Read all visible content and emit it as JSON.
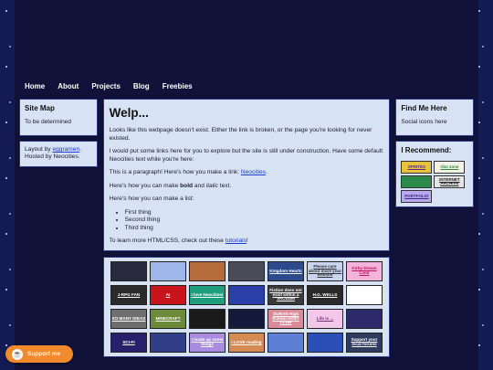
{
  "nav": {
    "items": [
      "Home",
      "About",
      "Projects",
      "Blog",
      "Freebies"
    ]
  },
  "left": {
    "sitemap_title": "Site Map",
    "sitemap_text": "To be determined",
    "credits_pre": "Layout by ",
    "credits_link": "eggramen",
    "credits_post": ".",
    "credits_line2": "Hosted by Neocities."
  },
  "main": {
    "title": "Welp...",
    "p1": "Looks like this webpage doesn't exist. Either the link is broken, or the page you're looking for never existed.",
    "p2": "I would put some links here for you to explore but the site is still under construction. Have some default Neocities text while you're here:",
    "p3_pre": "This is a paragraph! Here's how you make a link: ",
    "p3_link": "Neocities",
    "p3_post": ".",
    "p4_pre": "Here's how you can make ",
    "p4_bold": "bold",
    "p4_mid": " and ",
    "p4_italic": "italic",
    "p4_post": " text.",
    "p5": "Here's how you can make a list:",
    "list": [
      "First thing",
      "Second thing",
      "Third thing"
    ],
    "p6_pre": "To learn more HTML/CSS, check out these ",
    "p6_link": "tutorials",
    "p6_post": "!"
  },
  "right": {
    "findme_title": "Find Me Here",
    "findme_text": "Social icons here",
    "recommend_title": "I Recommend:",
    "badges": [
      "SPRITES",
      "ribo zone",
      "",
      "INTERNET ARCHIVE",
      "PORTFOLIO"
    ]
  },
  "buttons": [
    {
      "label": "",
      "bg": "#2a2a3e",
      "fg": "#ffffff"
    },
    {
      "label": "",
      "bg": "#9fb6e8",
      "fg": "#ffffff"
    },
    {
      "label": "",
      "bg": "#b56b3b",
      "fg": "#ffffff"
    },
    {
      "label": "",
      "bg": "#4a4a58",
      "fg": "#ffffff"
    },
    {
      "label": "Kingdom Hearts",
      "bg": "#2c4a8c",
      "fg": "#ffffff"
    },
    {
      "label": "Please care about more your website",
      "bg": "#c9d4ee",
      "fg": "#333333"
    },
    {
      "label": "Kirby Dream Land",
      "bg": "#f4b3d8",
      "fg": "#c0185e"
    },
    {
      "label": "J-RPG FAN",
      "bg": "#2b2b2b",
      "fg": "#ffffff"
    },
    {
      "label": "AI",
      "bg": "#c8151c",
      "fg": "#ffffff"
    },
    {
      "label": "I love Neocities!",
      "bg": "#1f9e7e",
      "fg": "#ffffff"
    },
    {
      "label": "",
      "bg": "#2a3fa8",
      "fg": "#ffffff"
    },
    {
      "label": "Fiction does not exist within a VACUUM",
      "bg": "#3a3a3a",
      "fg": "#ffffff"
    },
    {
      "label": "H.G. WELLS",
      "bg": "#2a2a2a",
      "fg": "#ffffff"
    },
    {
      "label": "",
      "bg": "#ffffff",
      "fg": "#000000"
    },
    {
      "label": "SO MANY IDEAS",
      "bg": "#6e6e6e",
      "fg": "#ffffff"
    },
    {
      "label": "MINECRAFT",
      "bg": "#6b8a3a",
      "fg": "#ffffff"
    },
    {
      "label": "",
      "bg": "#1a1a1a",
      "fg": "#9bff5a"
    },
    {
      "label": "",
      "bg": "#141b3a",
      "fg": "#ffffff"
    },
    {
      "label": "OURAN High School HOST CLUB",
      "bg": "#d98a96",
      "fg": "#ffffff"
    },
    {
      "label": "Life is ...",
      "bg": "#f3c7ea",
      "fg": "#7a2f7a"
    },
    {
      "label": "",
      "bg": "#2c2a6a",
      "fg": "#ffffff"
    },
    {
      "label": "SCI-FI",
      "bg": "#2a1f6a",
      "fg": "#ffffff"
    },
    {
      "label": "",
      "bg": "#2f3e86",
      "fg": "#ffffff"
    },
    {
      "label": "I made up some things",
      "bg": "#a98be0",
      "fg": "#ffffff"
    },
    {
      "label": "I LOVE reading",
      "bg": "#d58a54",
      "fg": "#ffffff"
    },
    {
      "label": "",
      "bg": "#5d7fd6",
      "fg": "#ffffff"
    },
    {
      "label": "",
      "bg": "#2a50b8",
      "fg": "#ffffff"
    },
    {
      "label": "Support your local forums",
      "bg": "#2e3a5e",
      "fg": "#ffffff"
    }
  ],
  "support": {
    "label": "Support me"
  }
}
